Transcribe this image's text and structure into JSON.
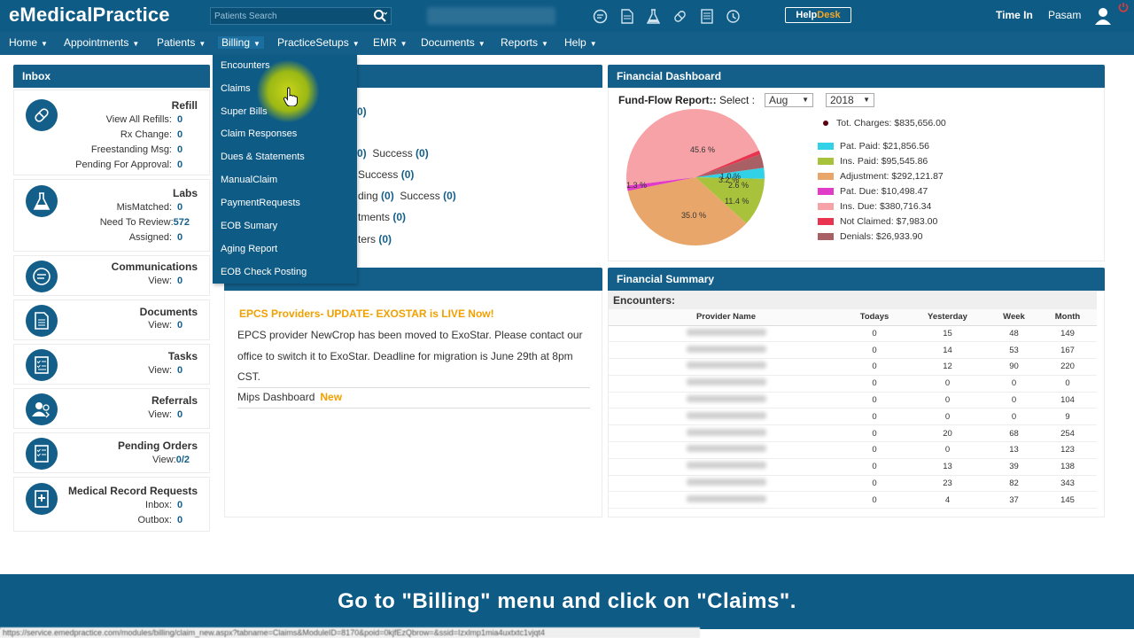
{
  "app": {
    "logo": "eMedicalPractice"
  },
  "topbar": {
    "search_placeholder": "Patients Search",
    "helpdesk_a": "Help",
    "helpdesk_b": "Desk",
    "time_in": "Time In",
    "user": "Pasam",
    "icons": [
      "chat-icon",
      "document-icon",
      "flask-icon",
      "pill-icon",
      "list-icon",
      "history-icon"
    ]
  },
  "nav": {
    "home": "Home",
    "appointments": "Appointments",
    "patients": "Patients",
    "billing": "Billing",
    "practicesetups": "PracticeSetups",
    "emr": "EMR",
    "documents": "Documents",
    "reports": "Reports",
    "help": "Help"
  },
  "billing_menu": {
    "items": [
      "Encounters",
      "Claims",
      "Super Bills",
      "Claim Responses",
      "Dues & Statements",
      "ManualClaim",
      "PaymentRequests",
      "EOB Sumary",
      "Aging Report",
      "EOB Check Posting"
    ]
  },
  "inbox": {
    "title": "Inbox",
    "refill": {
      "title": "Refill",
      "rows": [
        {
          "label": "View All Refills:",
          "value": "0"
        },
        {
          "label": "Rx Change:",
          "value": "0"
        },
        {
          "label": "Freestanding Msg:",
          "value": "0"
        },
        {
          "label": "Pending For Approval:",
          "value": "0"
        }
      ]
    },
    "labs": {
      "title": "Labs",
      "rows": [
        {
          "label": "MisMatched:",
          "value": "0"
        },
        {
          "label": "Need To Review:",
          "value": "572"
        },
        {
          "label": "Assigned:",
          "value": "0"
        }
      ]
    },
    "communications": {
      "title": "Communications",
      "view_label": "View:",
      "view": "0"
    },
    "documents": {
      "title": "Documents",
      "view_label": "View:",
      "view": "0"
    },
    "tasks": {
      "title": "Tasks",
      "view_label": "View:",
      "view": "0"
    },
    "referrals": {
      "title": "Referrals",
      "view_label": "View:",
      "view": "0"
    },
    "pending_orders": {
      "title": "Pending Orders",
      "view_label": "View:",
      "view": "0/2"
    },
    "medical_records": {
      "title": "Medical Record Requests",
      "inbox_label": "Inbox:",
      "inbox": "0",
      "outbox_label": "Outbox:",
      "outbox": "0"
    }
  },
  "middle": {
    "lines": [
      {
        "pre": "0)",
        "label": "Success",
        "value": "(0)"
      },
      {
        "pre": "",
        "label": "Success",
        "value": "(0)"
      },
      {
        "pre": "ding",
        "value0": "(0)",
        "label": "Success",
        "value": "(0)"
      },
      {
        "pre": "tments",
        "value": "(0)"
      },
      {
        "pre": "ters",
        "value": "(0)"
      }
    ],
    "partial_0": "0)"
  },
  "news": {
    "title": "EPCS Providers- UPDATE- EXOSTAR is LIVE Now!",
    "text": "EPCS provider NewCrop has been moved to ExoStar. Please contact our office to switch it to ExoStar. Deadline for migration is June 29th at 8pm CST.",
    "mips": "Mips Dashboard",
    "mips_new": "New"
  },
  "financial_dashboard": {
    "title": "Financial Dashboard",
    "ff_label": "Fund-Flow Report::",
    "select_label": "Select :",
    "month": "Aug",
    "year": "2018",
    "total": "Tot. Charges: $835,656.00",
    "legend": [
      {
        "label": "Pat. Paid: $21,856.56",
        "color": "#31d2e8"
      },
      {
        "label": "Ins. Paid: $95,545.86",
        "color": "#a9c23b"
      },
      {
        "label": "Adjustment: $292,121.87",
        "color": "#e8a66a"
      },
      {
        "label": "Pat. Due: $10,498.47",
        "color": "#e03cc8"
      },
      {
        "label": "Ins. Due: $380,716.34",
        "color": "#f7a2a6"
      },
      {
        "label": "Not Claimed: $7,983.00",
        "color": "#e8344f"
      },
      {
        "label": "Denials: $26,933.90",
        "color": "#a86064"
      }
    ]
  },
  "chart_data": {
    "type": "pie",
    "categories": [
      "Pat. Paid",
      "Ins. Paid",
      "Adjustment",
      "Pat. Due",
      "Ins. Due",
      "Not Claimed",
      "Denials"
    ],
    "values": [
      21856.56,
      95545.86,
      292121.87,
      10498.47,
      380716.34,
      7983.0,
      26933.9
    ],
    "colors": [
      "#31d2e8",
      "#a9c23b",
      "#e8a66a",
      "#e03cc8",
      "#f7a2a6",
      "#e8344f",
      "#a86064"
    ],
    "labels": [
      "2.6 %",
      "11.4 %",
      "35.0 %",
      "1.3 %",
      "45.6 %",
      "1.0 %",
      "3.2 %"
    ],
    "legend": "right"
  },
  "financial_summary": {
    "title": "Financial Summary",
    "encounters_label": "Encounters:",
    "headers": [
      "Provider Name",
      "Todays",
      "Yesterday",
      "Week",
      "Month"
    ],
    "rows": [
      [
        "0",
        "15",
        "48",
        "149"
      ],
      [
        "0",
        "14",
        "53",
        "167"
      ],
      [
        "0",
        "12",
        "90",
        "220"
      ],
      [
        "0",
        "0",
        "0",
        "0"
      ],
      [
        "0",
        "0",
        "0",
        "104"
      ],
      [
        "0",
        "0",
        "0",
        "9"
      ],
      [
        "0",
        "20",
        "68",
        "254"
      ],
      [
        "0",
        "0",
        "13",
        "123"
      ],
      [
        "0",
        "13",
        "39",
        "138"
      ],
      [
        "0",
        "23",
        "82",
        "343"
      ],
      [
        "0",
        "4",
        "37",
        "145"
      ]
    ]
  },
  "caption": "Go to \"Billing\" menu and click on \"Claims\".",
  "statusbar": "https://service.emedpractice.com/modules/billing/claim_new.aspx?tabname=Claims&ModuleID=8170&poid=0kjfEzQbrow=&ssid=Izxlmp1mia4uxtxtc1vjqt4"
}
